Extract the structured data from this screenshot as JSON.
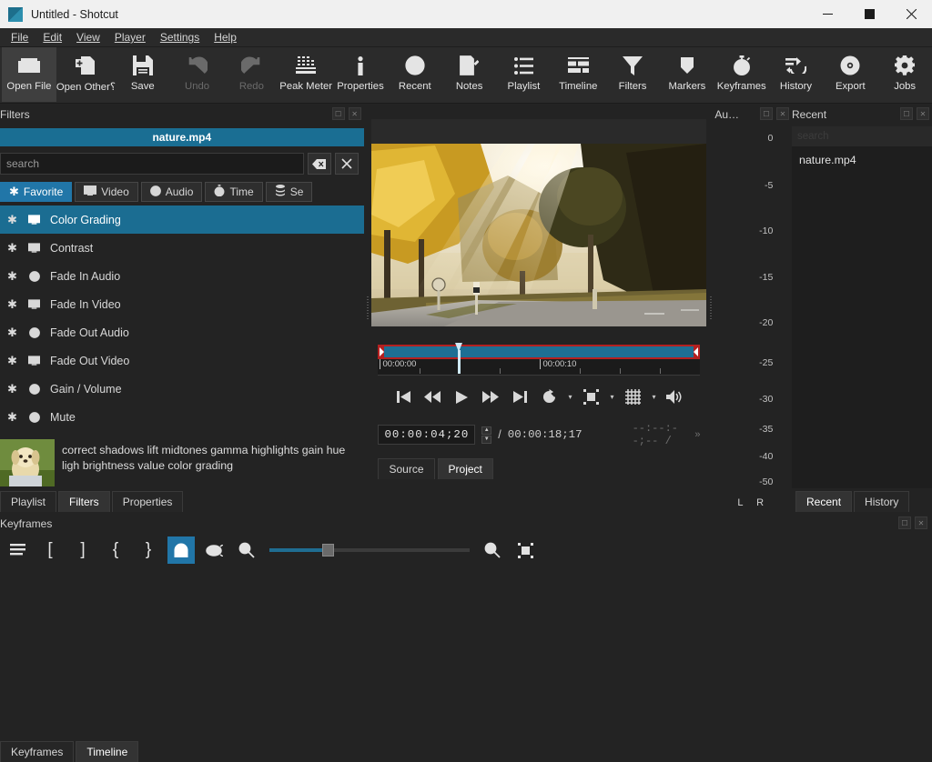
{
  "window": {
    "title": "Untitled - Shotcut",
    "minimize": "—",
    "maximize": "☐",
    "close": "✕"
  },
  "menubar": {
    "items": [
      "File",
      "Edit",
      "View",
      "Player",
      "Settings",
      "Help"
    ]
  },
  "toolbar": {
    "items": [
      {
        "label": "Open File",
        "icon": "folder-open-icon",
        "state": "active"
      },
      {
        "label": "Open Other⸮",
        "icon": "open-other-icon",
        "state": "normal"
      },
      {
        "label": "Save",
        "icon": "save-icon",
        "state": "normal"
      },
      {
        "label": "Undo",
        "icon": "undo-icon",
        "state": "disabled"
      },
      {
        "label": "Redo",
        "icon": "redo-icon",
        "state": "disabled"
      },
      {
        "label": "Peak Meter",
        "icon": "peak-meter-icon",
        "state": "normal"
      },
      {
        "label": "Properties",
        "icon": "info-icon",
        "state": "normal"
      },
      {
        "label": "Recent",
        "icon": "clock-icon",
        "state": "normal"
      },
      {
        "label": "Notes",
        "icon": "notes-icon",
        "state": "normal"
      },
      {
        "label": "Playlist",
        "icon": "list-icon",
        "state": "normal"
      },
      {
        "label": "Timeline",
        "icon": "timeline-icon",
        "state": "normal"
      },
      {
        "label": "Filters",
        "icon": "funnel-icon",
        "state": "normal"
      },
      {
        "label": "Markers",
        "icon": "marker-icon",
        "state": "normal"
      },
      {
        "label": "Keyframes",
        "icon": "stopwatch-icon",
        "state": "normal"
      },
      {
        "label": "History",
        "icon": "history-icon",
        "state": "normal"
      },
      {
        "label": "Export",
        "icon": "export-disc-icon",
        "state": "normal"
      },
      {
        "label": "Jobs",
        "icon": "gear-icon",
        "state": "normal"
      }
    ]
  },
  "filters_panel": {
    "title": "Filters",
    "clip_name": "nature.mp4",
    "search_placeholder": "search",
    "search_value": "",
    "clear_icon": "backspace-icon",
    "close_icon": "close-x-icon",
    "tabs": [
      {
        "label": "Favorite",
        "icon": "asterisk-icon",
        "active": true
      },
      {
        "label": "Video",
        "icon": "monitor-icon",
        "active": false
      },
      {
        "label": "Audio",
        "icon": "speaker-dot-icon",
        "active": false
      },
      {
        "label": "Time",
        "icon": "stopwatch-icon",
        "active": false
      },
      {
        "label": "Se",
        "icon": "sets-icon",
        "active": false
      }
    ],
    "list": [
      {
        "name": "Color Grading",
        "type": "video",
        "favorite": true,
        "selected": true
      },
      {
        "name": "Contrast",
        "type": "video",
        "favorite": true,
        "selected": false
      },
      {
        "name": "Fade In Audio",
        "type": "audio",
        "favorite": true,
        "selected": false
      },
      {
        "name": "Fade In Video",
        "type": "video",
        "favorite": true,
        "selected": false
      },
      {
        "name": "Fade Out Audio",
        "type": "audio",
        "favorite": true,
        "selected": false
      },
      {
        "name": "Fade Out Video",
        "type": "video",
        "favorite": true,
        "selected": false
      },
      {
        "name": "Gain / Volume",
        "type": "audio",
        "favorite": true,
        "selected": false
      },
      {
        "name": "Mute",
        "type": "audio",
        "favorite": true,
        "selected": false
      }
    ],
    "description": "correct shadows lift midtones gamma highlights gain hue ligh brightness value color grading",
    "bottom_tabs": [
      {
        "label": "Playlist",
        "active": false
      },
      {
        "label": "Filters",
        "active": true
      },
      {
        "label": "Properties",
        "active": false
      }
    ]
  },
  "player": {
    "scrub": {
      "ruler_labels": [
        "00:00:00",
        "00:00:10"
      ],
      "playhead_position_pct": 25
    },
    "transport": [
      {
        "name": "skip-to-start-button",
        "icon": "skip-start-icon"
      },
      {
        "name": "rewind-button",
        "icon": "rewind-icon"
      },
      {
        "name": "play-button",
        "icon": "play-icon"
      },
      {
        "name": "fast-forward-button",
        "icon": "fast-forward-icon"
      },
      {
        "name": "skip-to-end-button",
        "icon": "skip-end-icon"
      },
      {
        "name": "loop-button",
        "icon": "loop-icon"
      },
      {
        "name": "zoom-fit-button",
        "icon": "zoom-fit-icon"
      },
      {
        "name": "grid-button",
        "icon": "grid-icon"
      },
      {
        "name": "volume-button",
        "icon": "volume-icon"
      }
    ],
    "timecode_current": "00:00:04;20",
    "timecode_separator": "/",
    "timecode_total": "00:00:18;17",
    "timecode_selected": "--:--:--;-- /",
    "overflow_icon": "»",
    "source_project_tabs": [
      {
        "label": "Source",
        "active": false
      },
      {
        "label": "Project",
        "active": true
      }
    ]
  },
  "peak_meter": {
    "title": "Au…",
    "scale": [
      "0",
      "-5",
      "-10",
      "-15",
      "-20",
      "-25",
      "-30",
      "-35",
      "-40",
      "-50"
    ],
    "channels": "L R"
  },
  "recent_panel": {
    "title": "Recent",
    "search_placeholder": "search",
    "items": [
      "nature.mp4"
    ],
    "tabs": [
      {
        "label": "Recent",
        "active": true
      },
      {
        "label": "History",
        "active": false
      }
    ]
  },
  "keyframes_panel": {
    "title": "Keyframes",
    "toolbar": [
      {
        "name": "menu-button",
        "icon": "hamburger-icon",
        "glyph": "☰",
        "on": false
      },
      {
        "name": "set-filter-start",
        "icon": "bracket-open-icon",
        "glyph": "[",
        "on": false
      },
      {
        "name": "set-filter-end",
        "icon": "bracket-close-icon",
        "glyph": "]",
        "on": false
      },
      {
        "name": "set-first-simple-kf",
        "icon": "brace-open-icon",
        "glyph": "{",
        "on": false
      },
      {
        "name": "set-second-simple-kf",
        "icon": "brace-close-icon",
        "glyph": "}",
        "on": false
      },
      {
        "name": "snap-toggle",
        "icon": "magnet-icon",
        "glyph": "",
        "on": true
      },
      {
        "name": "scrub-while-dragging",
        "icon": "eye-icon",
        "glyph": "",
        "on": false
      },
      {
        "name": "zoom-out-button",
        "icon": "zoom-out-icon",
        "glyph": "",
        "on": false
      },
      {
        "name": "zoom-in-button",
        "icon": "zoom-in-icon",
        "glyph": "",
        "on": false
      },
      {
        "name": "zoom-fit-button",
        "icon": "zoom-fit-icon",
        "glyph": "",
        "on": false
      }
    ]
  },
  "bottom_tabs": [
    {
      "label": "Keyframes",
      "active": false
    },
    {
      "label": "Timeline",
      "active": true
    }
  ],
  "colors": {
    "accent": "#1b6d92",
    "selection": "#2176a8",
    "trim": "#b42020",
    "window_bg": "#232323",
    "titlebar_bg": "#f0f0f0"
  }
}
